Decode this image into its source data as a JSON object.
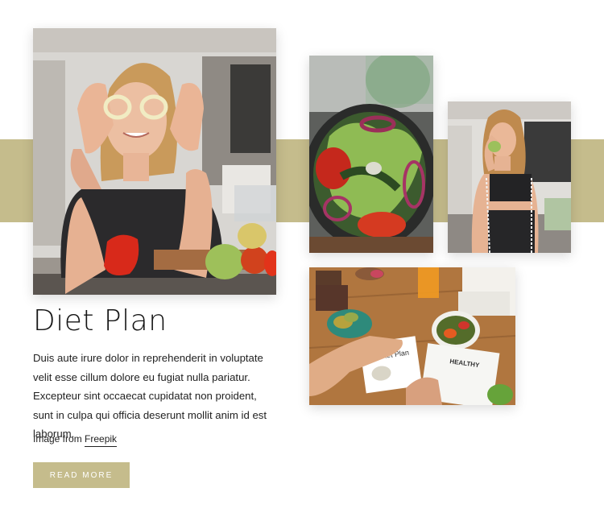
{
  "title": "Diet Plan",
  "description": "Duis aute irure dolor in reprehenderit in voluptate velit esse cillum dolore eu fugiat nulla pariatur. Excepteur sint occaecat cupidatat non proident, sunt in culpa qui officia deserunt mollit anim id est laborum.",
  "credit": {
    "prefix": "Image from ",
    "link": "Freepik"
  },
  "button": {
    "label": "READ MORE"
  },
  "photo_labels": {
    "notebook_title": "Diet Plan",
    "sheet_title": "HEALTHY"
  },
  "colors": {
    "accent": "#c5bc8c",
    "text": "#222222",
    "background": "#ffffff"
  }
}
